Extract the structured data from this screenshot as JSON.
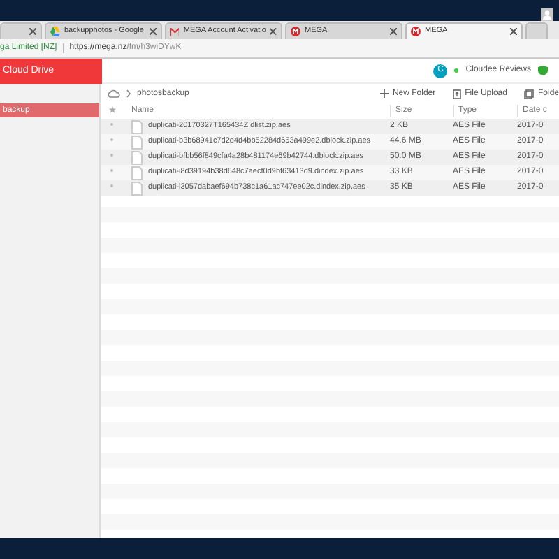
{
  "browser": {
    "tabs": [
      {
        "selected": false
      },
      {
        "title": "backupphotos - Google",
        "selected": false
      },
      {
        "title": "MEGA Account Activatio",
        "selected": false
      },
      {
        "title": "MEGA",
        "selected": false
      },
      {
        "title": "MEGA",
        "selected": true
      }
    ],
    "address": {
      "site": "ga Limited [NZ]",
      "url_host": "https://mega.nz",
      "url_path": "/fm/h3wiDYwK"
    }
  },
  "header": {
    "title": "Cloud Drive",
    "avatar": "C",
    "account": "Cloudee Reviews"
  },
  "sidebar": {
    "items": [
      {
        "label": "backup",
        "selected": true
      }
    ]
  },
  "toolbar": {
    "breadcrumb": "photosbackup",
    "buttons": [
      "New Folder",
      "File Upload",
      "Folde"
    ]
  },
  "table": {
    "columns": [
      "Name",
      "Size",
      "Type",
      "Date c"
    ],
    "rows": [
      {
        "name": "duplicati-20170327T165434Z.dlist.zip.aes",
        "size": "2 KB",
        "type": "AES File",
        "date": "2017-0"
      },
      {
        "name": "duplicati-b3b68941c7d2d4d4bb52284d653a499e2.dblock.zip.aes",
        "size": "44.6 MB",
        "type": "AES File",
        "date": "2017-0"
      },
      {
        "name": "duplicati-bfbb56f849cfa4a28b481174e69b42744.dblock.zip.aes",
        "size": "50.0 MB",
        "type": "AES File",
        "date": "2017-0"
      },
      {
        "name": "duplicati-i8d39194b38d648c7aecf0d9bf63413d9.dindex.zip.aes",
        "size": "33 KB",
        "type": "AES File",
        "date": "2017-0"
      },
      {
        "name": "duplicati-i3057dabaef694b738c1a61ac747ee02c.dindex.zip.aes",
        "size": "35 KB",
        "type": "AES File",
        "date": "2017-0"
      }
    ]
  }
}
